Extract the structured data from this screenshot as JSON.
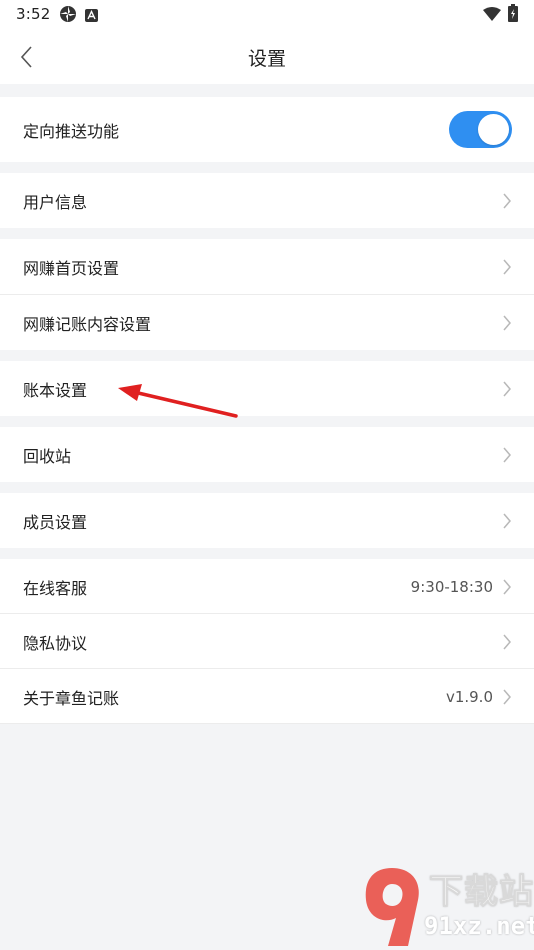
{
  "status_bar": {
    "time": "3:52",
    "left_icons": [
      "pinwheel-icon",
      "a-badge-icon"
    ],
    "right_icons": [
      "wifi-icon",
      "battery-icon"
    ]
  },
  "header": {
    "title": "设置",
    "back_icon": "chevron-left-icon"
  },
  "settings": {
    "push": {
      "label": "定向推送功能",
      "enabled": true,
      "accent": "#2f8ff1"
    },
    "user_info": {
      "label": "用户信息"
    },
    "homepage": {
      "label": "网赚首页设置"
    },
    "record_content": {
      "label": "网赚记账内容设置"
    },
    "ledger": {
      "label": "账本设置"
    },
    "recycle": {
      "label": "回收站"
    },
    "members": {
      "label": "成员设置"
    },
    "service": {
      "label": "在线客服",
      "value": "9:30-18:30"
    },
    "privacy": {
      "label": "隐私协议"
    },
    "about": {
      "label": "关于章鱼记账",
      "value": "v1.9.0"
    }
  },
  "annotation": {
    "arrow_color": "#e02020"
  },
  "watermark": {
    "top_text": "下载站",
    "bottom_text": "91xz.net",
    "logo_color": "#e8453c"
  }
}
